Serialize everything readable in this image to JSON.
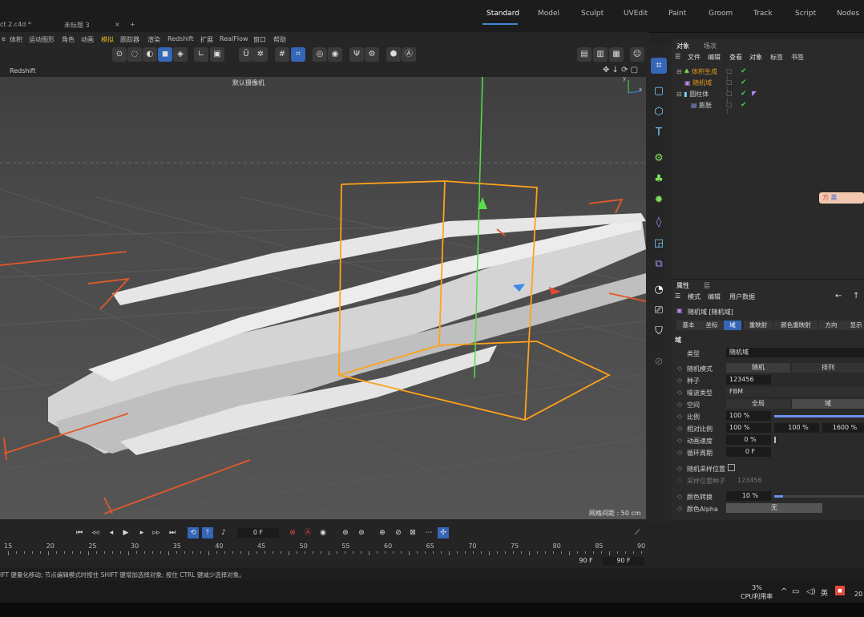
{
  "window": {
    "tabs": [
      "ct 2.c4d *",
      "未标题 3"
    ],
    "close_glyph": "×",
    "add_glyph": "+",
    "workspaces": [
      "Standard",
      "Model",
      "Sculpt",
      "UVEdit",
      "Paint",
      "Groom",
      "Track",
      "Script",
      "Nodes"
    ],
    "active_workspace": "Standard"
  },
  "menubar": [
    "体积",
    "运动图形",
    "角色",
    "动画",
    "模拟",
    "跟踪器",
    "渲染",
    "Redshift",
    "扩展",
    "RealFlow",
    "窗口",
    "帮助"
  ],
  "menubar_prefix": "e",
  "viewport": {
    "header_left": "Redshift",
    "camera_label": "默认摄像机",
    "camera_icon": "camera-glyph",
    "grid_label": "网格间距 : 50 cm",
    "axis_x": "x",
    "axis_y": "y"
  },
  "object_manager": {
    "tabs": [
      "对象",
      "场次"
    ],
    "menu": [
      "文件",
      "编辑",
      "查看",
      "对象",
      "标签",
      "书签"
    ],
    "objects": [
      {
        "name": "体积生成",
        "color": "#e29a1b",
        "indent": 0
      },
      {
        "name": "随机域",
        "color": "#e29a1b",
        "indent": 1
      },
      {
        "name": "圆柱体",
        "color": "#cfcfcf",
        "indent": 0
      },
      {
        "name": "膨胀",
        "color": "#cfcfcf",
        "indent": 1
      }
    ],
    "ime_badge": "英"
  },
  "attributes": {
    "tabs": [
      "属性",
      "层"
    ],
    "menu": [
      "模式",
      "编辑",
      "用户数据"
    ],
    "title": "随机域 [随机域]",
    "subtabs": [
      "基本",
      "坐标",
      "域",
      "重映射",
      "颜色重映射",
      "方向",
      "显示"
    ],
    "active_subtab": "域",
    "section": "域",
    "rows": {
      "type_label": "类型",
      "type_value": "随机域",
      "mode_label": "随机模式",
      "mode_a": "随机",
      "mode_b": "排列",
      "seed_label": "种子",
      "seed_value": "123456",
      "noise_label": "噪波类型",
      "noise_value": "FBM",
      "space_label": "空间",
      "space_a": "全局",
      "space_b": "域",
      "scale_label": "比例",
      "scale_value": "100 %",
      "rel_label": "相对比例",
      "rel_a": "100 %",
      "rel_b": "100 %",
      "rel_c": "1600 %",
      "anim_label": "动画速度",
      "anim_value": "0 %",
      "loop_label": "循环周期",
      "loop_value": "0 F",
      "sample_label": "随机采样位置",
      "sampleseed_label": "采样位置种子",
      "sampleseed_value": "123456",
      "color_label": "颜色转换",
      "color_value": "10 %",
      "alpha_label": "颜色Alpha",
      "alpha_value": "无"
    },
    "scale_level": 1.0,
    "color_level": 0.1
  },
  "timeline": {
    "current_frame": "0 F",
    "ticks": [
      "15",
      "20",
      "25",
      "30",
      "35",
      "40",
      "45",
      "50",
      "55",
      "60",
      "65",
      "70",
      "75",
      "80",
      "85",
      "90"
    ],
    "end_a": "90 F",
    "end_b": "90 F"
  },
  "status": {
    "text": "IFT 键量化移动; 节点编辑模式时按住 SHIFT 键增加选择对象; 按住 CTRL 键减少选择对象。"
  },
  "taskbar": {
    "cpu_percent": "3%",
    "cpu_label": "CPU利用率",
    "ime": "英",
    "year_fragment": "20"
  }
}
